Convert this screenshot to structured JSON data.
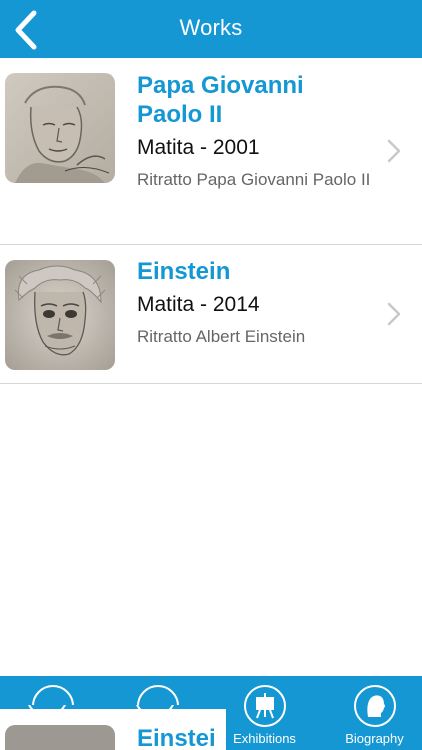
{
  "navbar": {
    "title": "Works",
    "back_icon": "chevron-left-icon"
  },
  "works": [
    {
      "title": "Papa Giovanni Paolo II",
      "subtitle": "Matita - 2001",
      "description": "Ritratto Papa Giovanni Paolo II",
      "thumbnail": "pencil-portrait-pope"
    },
    {
      "title": "Einstein",
      "subtitle": "Matita - 2014",
      "description": "Ritratto Albert Einstein",
      "thumbnail": "pencil-portrait-einstein"
    }
  ],
  "tabbar": {
    "tabs": [
      {
        "label": "",
        "icon": "home-icon"
      },
      {
        "label": "",
        "icon": "works-icon"
      },
      {
        "label": "Exhibitions",
        "icon": "easel-icon"
      },
      {
        "label": "Biography",
        "icon": "profile-icon"
      }
    ]
  },
  "glitch": {
    "text": "Einstei"
  },
  "colors": {
    "accent": "#1597d3",
    "separator": "#d6d6d6",
    "chevron": "#c8c8cd"
  }
}
